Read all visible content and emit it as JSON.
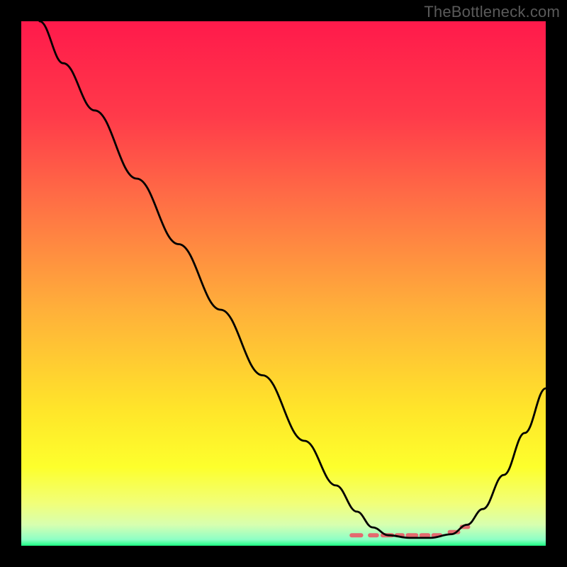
{
  "watermark": "TheBottleneck.com",
  "chart_data": {
    "type": "line",
    "title": "",
    "xlabel": "",
    "ylabel": "",
    "xlim": [
      0,
      100
    ],
    "ylim": [
      0,
      100
    ],
    "gradient_stops": [
      {
        "offset": 0,
        "color": "#ff1a4b"
      },
      {
        "offset": 18,
        "color": "#ff3a4a"
      },
      {
        "offset": 35,
        "color": "#ff7145"
      },
      {
        "offset": 55,
        "color": "#ffb03a"
      },
      {
        "offset": 74,
        "color": "#ffe52a"
      },
      {
        "offset": 85,
        "color": "#fdff2c"
      },
      {
        "offset": 92,
        "color": "#f1ff7a"
      },
      {
        "offset": 96,
        "color": "#d7ffb0"
      },
      {
        "offset": 98.8,
        "color": "#8effc6"
      },
      {
        "offset": 100,
        "color": "#1dff84"
      }
    ],
    "series": [
      {
        "name": "curve",
        "color": "#000000",
        "stroke_width": 2.8,
        "points": [
          {
            "x": 3.5,
            "y": 100.0
          },
          {
            "x": 8.0,
            "y": 92.0
          },
          {
            "x": 14.0,
            "y": 83.0
          },
          {
            "x": 22.0,
            "y": 70.0
          },
          {
            "x": 30.0,
            "y": 57.5
          },
          {
            "x": 38.0,
            "y": 45.0
          },
          {
            "x": 46.0,
            "y": 32.5
          },
          {
            "x": 54.0,
            "y": 20.0
          },
          {
            "x": 60.0,
            "y": 11.5
          },
          {
            "x": 64.0,
            "y": 6.5
          },
          {
            "x": 67.0,
            "y": 3.5
          },
          {
            "x": 70.0,
            "y": 2.0
          },
          {
            "x": 74.0,
            "y": 1.5
          },
          {
            "x": 78.0,
            "y": 1.5
          },
          {
            "x": 82.0,
            "y": 2.2
          },
          {
            "x": 85.0,
            "y": 4.0
          },
          {
            "x": 88.0,
            "y": 7.0
          },
          {
            "x": 92.0,
            "y": 13.5
          },
          {
            "x": 96.0,
            "y": 21.5
          },
          {
            "x": 100.0,
            "y": 30.0
          }
        ]
      },
      {
        "name": "floor-markers",
        "color": "#e46a6f",
        "stroke_width": 6,
        "segments": [
          {
            "x1": 63.0,
            "y1": 2.0,
            "x2": 64.8,
            "y2": 2.0
          },
          {
            "x1": 66.5,
            "y1": 2.0,
            "x2": 67.8,
            "y2": 2.0
          },
          {
            "x1": 68.9,
            "y1": 2.0,
            "x2": 70.7,
            "y2": 2.0
          },
          {
            "x1": 71.6,
            "y1": 2.0,
            "x2": 72.7,
            "y2": 2.0
          },
          {
            "x1": 73.7,
            "y1": 2.0,
            "x2": 75.3,
            "y2": 2.0
          },
          {
            "x1": 76.3,
            "y1": 2.0,
            "x2": 77.6,
            "y2": 2.0
          },
          {
            "x1": 78.6,
            "y1": 2.0,
            "x2": 79.9,
            "y2": 2.0
          },
          {
            "x1": 81.7,
            "y1": 2.6,
            "x2": 83.3,
            "y2": 2.6
          },
          {
            "x1": 84.0,
            "y1": 3.6,
            "x2": 85.2,
            "y2": 3.6
          }
        ]
      }
    ]
  }
}
